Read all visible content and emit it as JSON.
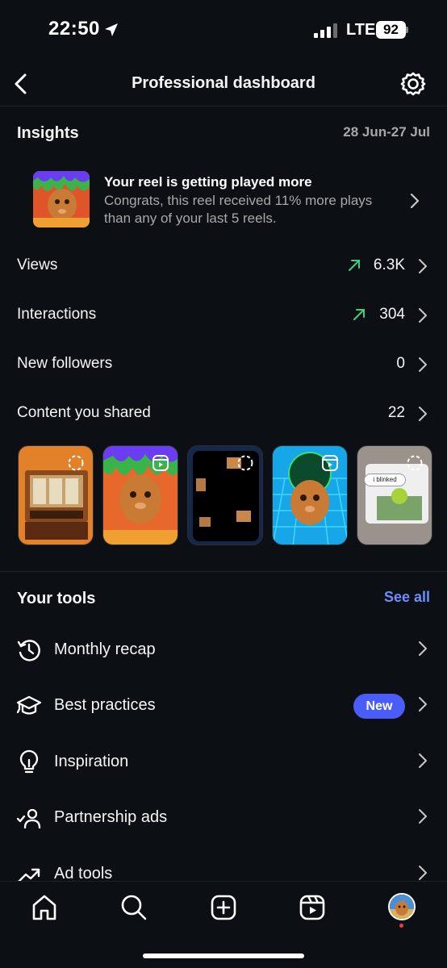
{
  "status_bar": {
    "time": "22:50",
    "network": "LTE",
    "battery": "92"
  },
  "header": {
    "title": "Professional dashboard",
    "back_icon": "chevron-left-icon",
    "settings_icon": "gear-icon"
  },
  "insights": {
    "title": "Insights",
    "date_range": "28 Jun-27 Jul",
    "highlight": {
      "title": "Your reel is getting played more",
      "description": "Congrats, this reel received 11% more plays than any of your last 5 reels."
    },
    "metrics": [
      {
        "label": "Views",
        "value": "6.3K",
        "trend": "up"
      },
      {
        "label": "Interactions",
        "value": "304",
        "trend": "up"
      },
      {
        "label": "New followers",
        "value": "0",
        "trend": ""
      },
      {
        "label": "Content you shared",
        "value": "22",
        "trend": ""
      }
    ],
    "content_cards": [
      {
        "kind": "story",
        "caption": ""
      },
      {
        "kind": "reel",
        "caption": ""
      },
      {
        "kind": "story",
        "caption": ""
      },
      {
        "kind": "reel",
        "caption": ""
      },
      {
        "kind": "story",
        "caption": "i blinked"
      }
    ]
  },
  "tools": {
    "title": "Your tools",
    "see_all": "See all",
    "items": [
      {
        "label": "Monthly recap",
        "icon": "history-icon",
        "badge": ""
      },
      {
        "label": "Best practices",
        "icon": "graduation-cap-icon",
        "badge": "New"
      },
      {
        "label": "Inspiration",
        "icon": "lightbulb-icon",
        "badge": ""
      },
      {
        "label": "Partnership ads",
        "icon": "partnership-person-icon",
        "badge": ""
      },
      {
        "label": "Ad tools",
        "icon": "trending-up-icon",
        "badge": ""
      }
    ]
  },
  "tab_bar": {
    "items": [
      "home-icon",
      "search-icon",
      "create-icon",
      "reels-icon",
      "profile-avatar"
    ]
  },
  "colors": {
    "background": "#0c1014",
    "accent_link": "#708dff",
    "badge": "#4a5df9",
    "trend_up": "#3ed17a",
    "notification_dot": "#ff3040"
  }
}
